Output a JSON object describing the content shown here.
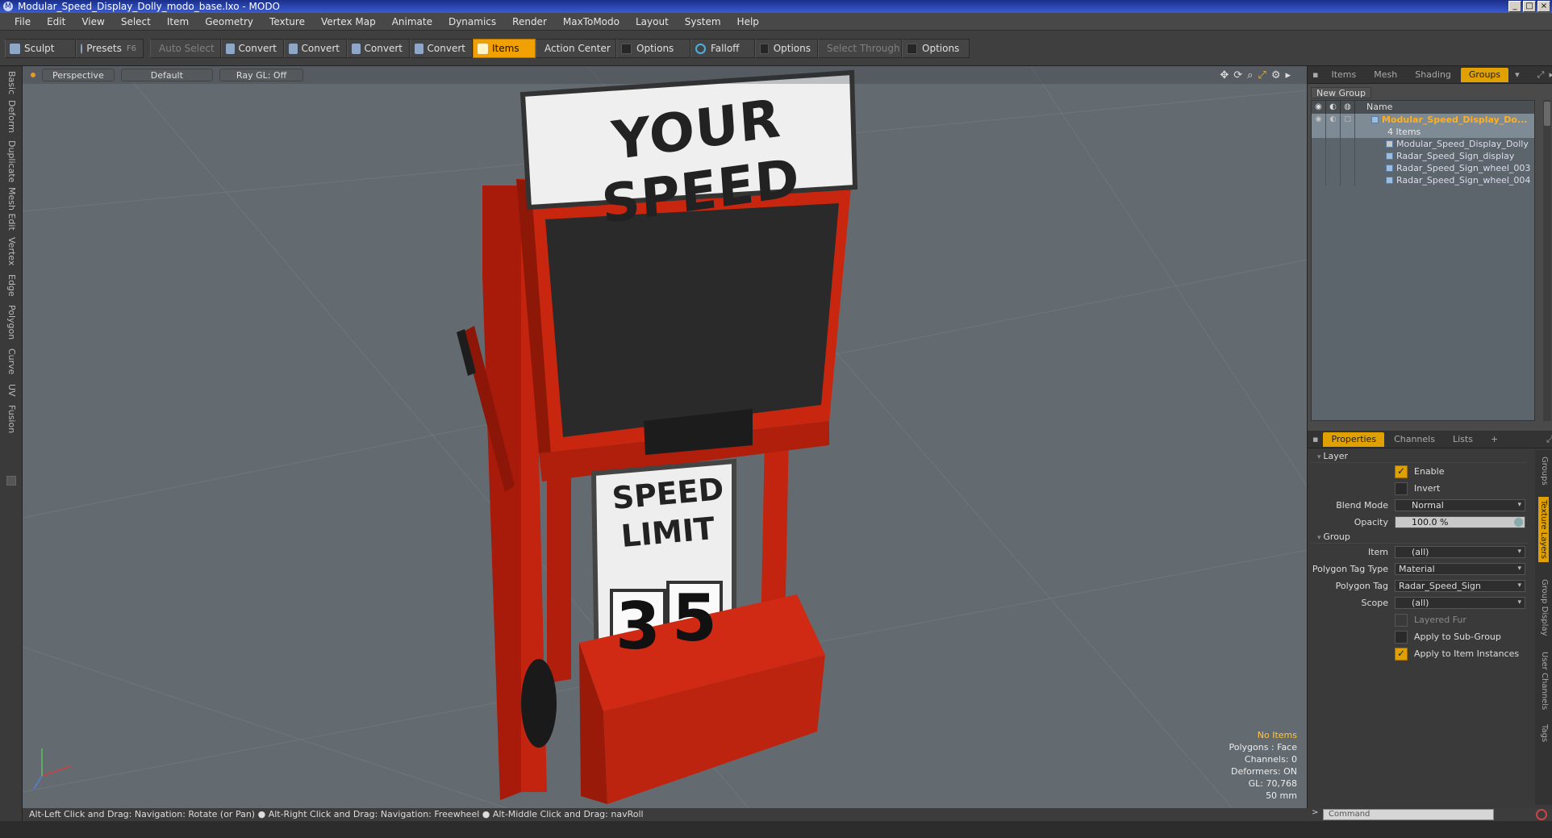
{
  "window": {
    "title": "Modular_Speed_Display_Dolly_modo_base.lxo - MODO"
  },
  "menu": [
    "File",
    "Edit",
    "View",
    "Select",
    "Item",
    "Geometry",
    "Texture",
    "Vertex Map",
    "Animate",
    "Dynamics",
    "Render",
    "MaxToModo",
    "Layout",
    "System",
    "Help"
  ],
  "toolbar": {
    "sculpt": "Sculpt",
    "presets": "Presets",
    "presets_key": "F6",
    "auto_select": "Auto Select",
    "convert1": "Convert",
    "convert2": "Convert",
    "convert3": "Convert",
    "convert4": "Convert",
    "items": "Items",
    "action_center": "Action Center",
    "options1": "Options",
    "falloff": "Falloff",
    "options2": "Options",
    "select_through": "Select Through",
    "options3": "Options"
  },
  "left_tabs": [
    "Basic",
    "Deform",
    "Duplicate",
    "Mesh Edit",
    "Vertex",
    "Edge",
    "Polygon",
    "Curve",
    "UV",
    "Fusion"
  ],
  "viewport": {
    "view": "Perspective",
    "shading": "Default",
    "raygl": "Ray GL: Off",
    "info": {
      "selection": "No Items",
      "polygons": "Polygons : Face",
      "channels": "Channels: 0",
      "deformers": "Deformers: ON",
      "gl": "GL: 70,768",
      "lens": "50 mm"
    },
    "sign_top": "YOUR SPEED",
    "sign_speed": "SPEED",
    "sign_limit": "LIMIT",
    "digit1": "3",
    "digit2": "5"
  },
  "panel_tabs": [
    "Items",
    "Mesh ...",
    "Shading",
    "Groups"
  ],
  "groups": {
    "new_group": "New Group",
    "column_name": "Name",
    "root": "Modular_Speed_Display_Do...",
    "root_count": "4 Items",
    "children": [
      "Modular_Speed_Display_Dolly",
      "Radar_Speed_Sign_display",
      "Radar_Speed_Sign_wheel_003",
      "Radar_Speed_Sign_wheel_004"
    ]
  },
  "prop_tabs": [
    "Properties",
    "Channels",
    "Lists",
    "+"
  ],
  "props": {
    "layer": "Layer",
    "enable": "Enable",
    "invert": "Invert",
    "blend_mode_label": "Blend Mode",
    "blend_mode": "Normal",
    "opacity_label": "Opacity",
    "opacity": "100.0 %",
    "group": "Group",
    "item_label": "Item",
    "item": "(all)",
    "ptt_label": "Polygon Tag Type",
    "ptt": "Material",
    "ptag_label": "Polygon Tag",
    "ptag": "Radar_Speed_Sign",
    "scope_label": "Scope",
    "scope": "(all)",
    "layered_fur": "Layered Fur",
    "apply_sub": "Apply to Sub-Group",
    "apply_inst": "Apply to Item Instances"
  },
  "right_vtabs": [
    "Groups",
    "Texture Layers",
    "Group Display",
    "User Channels",
    "Tags"
  ],
  "statusbar": "Alt-Left Click and Drag: Navigation: Rotate (or Pan) ● Alt-Right Click and Drag: Navigation: Freewheel ● Alt-Middle Click and Drag: navRoll",
  "command_placeholder": "Command",
  "colors": {
    "accent": "#e0a000",
    "viewport": "#646b70",
    "dolly_red": "#d42a14"
  }
}
